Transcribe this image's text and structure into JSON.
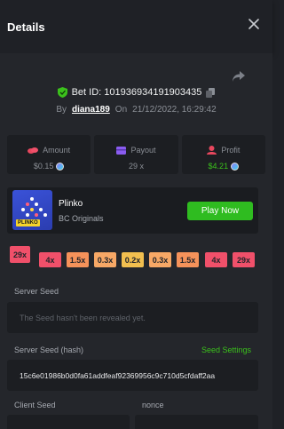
{
  "header": {
    "title": "Details"
  },
  "bet": {
    "id_label": "Bet ID: 101936934191903435",
    "by_label": "By",
    "user": "diana189",
    "on_label": "On",
    "date": "21/12/2022, 16:29:42"
  },
  "stats": [
    {
      "label": "Amount",
      "value": "$0.15",
      "icon": "coins-icon"
    },
    {
      "label": "Payout",
      "value": "29 x",
      "icon": "wallet-icon"
    },
    {
      "label": "Profit",
      "value": "$4.21",
      "icon": "profit-icon"
    }
  ],
  "game": {
    "name": "Plinko",
    "provider": "BC Originals",
    "play_label": "Play Now",
    "thumb_text": "PLINKO"
  },
  "multipliers": [
    "29x",
    "4x",
    "1.5x",
    "0.3x",
    "0.2x",
    "0.3x",
    "1.5x",
    "4x",
    "29x"
  ],
  "seeds": {
    "server_label": "Server Seed",
    "server_placeholder": "The Seed hasn't been revealed yet.",
    "hash_label": "Server Seed (hash)",
    "settings_label": "Seed Settings",
    "hash_value": "15c6e01986b0d0fa61addfeaf92369956c9c710d5cfdaff2aa",
    "client_label": "Client Seed",
    "nonce_label": "nonce"
  },
  "colors": {
    "accent_green": "#3bc11c",
    "play_button": "#2fbc20",
    "mult_red": "#f0506a",
    "mult_orange": "#f5925a",
    "mult_light_orange": "#f7a866",
    "mult_yellow": "#f2bf4f"
  }
}
